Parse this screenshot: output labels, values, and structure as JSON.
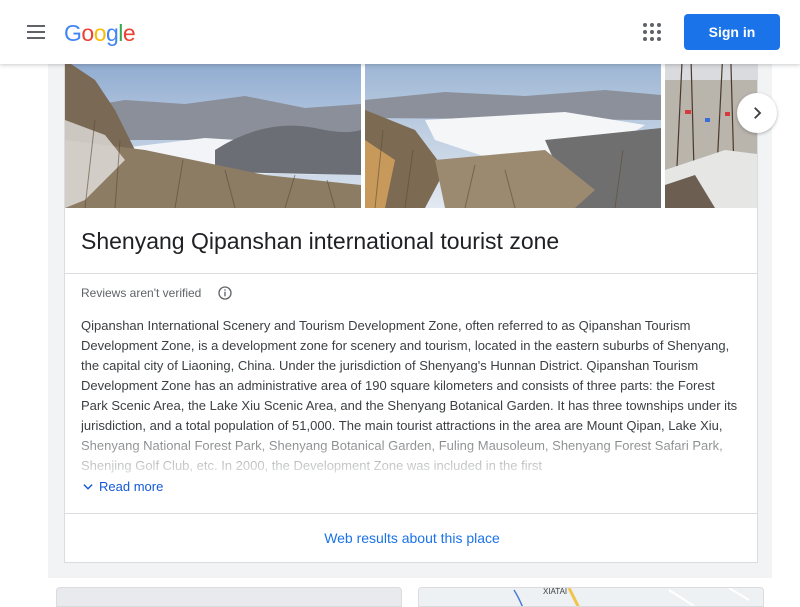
{
  "header": {
    "logo_letters": [
      {
        "ch": "G",
        "color": "#4285F4"
      },
      {
        "ch": "o",
        "color": "#EA4335"
      },
      {
        "ch": "o",
        "color": "#FBBC05"
      },
      {
        "ch": "g",
        "color": "#4285F4"
      },
      {
        "ch": "l",
        "color": "#34A853"
      },
      {
        "ch": "e",
        "color": "#EA4335"
      }
    ],
    "signin_label": "Sign in",
    "menu_icon": "hamburger-menu-icon",
    "apps_icon": "apps-grid-icon"
  },
  "place": {
    "title": "Shenyang Qipanshan international tourist zone",
    "reviews_notice": "Reviews aren't verified",
    "description": "Qipanshan International Scenery and Tourism Development Zone, often referred to as Qipanshan Tourism Development Zone, is a development zone for scenery and tourism, located in the eastern suburbs of Shenyang, the capital city of Liaoning, China. Under the jurisdiction of Shenyang's Hunnan District. Qipanshan Tourism Development Zone has an administrative area of 190 square kilometers and consists of three parts: the Forest Park Scenic Area, the Lake Xiu Scenic Area, and the Shenyang Botanical Garden. It has three townships under its jurisdiction, and a total population of 51,000. The main tourist attractions in the area are Mount Qipan, Lake Xiu, Shenyang National Forest Park, Shenyang Botanical Garden, Fuling Mausoleum, Shenyang Forest Safari Park, Shenjing Golf Club, etc. In 2000, the Development Zone was included in the first",
    "read_more_label": "Read more",
    "web_results_label": "Web results about this place"
  },
  "photos": [
    "photo-1",
    "photo-2",
    "photo-3"
  ],
  "map_preview": {
    "label": "XIATAI"
  },
  "colors": {
    "accent": "#1a73e8",
    "panel_bg": "#f1f3f4",
    "border": "#dadce0"
  }
}
